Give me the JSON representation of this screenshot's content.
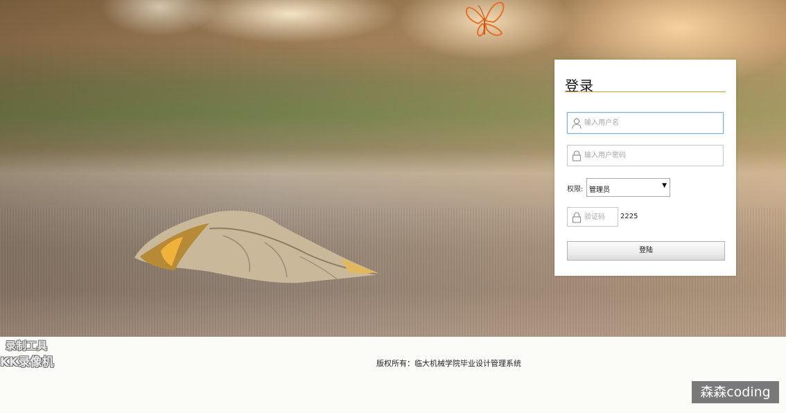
{
  "login": {
    "title": "登录",
    "username_placeholder": "输入用户名",
    "password_placeholder": "输入用户密码",
    "role_label": "权限:",
    "role_selected": "管理员",
    "captcha_placeholder": "验证码",
    "captcha_code": "2225",
    "submit_label": "登陆"
  },
  "footer": {
    "copyright": "版权所有：临大机械学院毕业设计管理系统"
  },
  "watermarks": {
    "recorder_line1": "录制工具",
    "recorder_line2": "KK录像机",
    "channel_badge": "森森coding"
  },
  "colors": {
    "accent_rule": "#d09a3a",
    "focus_border": "#7fb0d8"
  },
  "icons": {
    "username": "user-icon",
    "password": "lock-icon",
    "captcha": "lock-icon",
    "select": "caret-down-icon"
  }
}
